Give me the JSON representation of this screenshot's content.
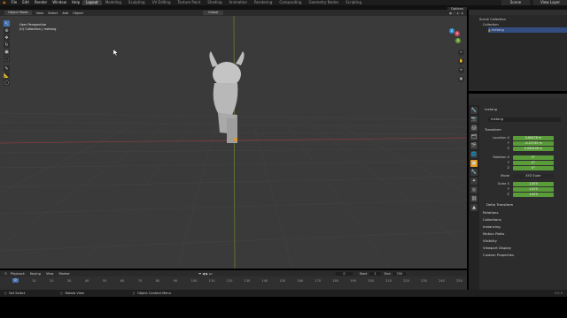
{
  "topbar": {
    "menus": [
      "File",
      "Edit",
      "Render",
      "Window",
      "Help"
    ],
    "workspaces": [
      "Layout",
      "Modeling",
      "Sculpting",
      "UV Editing",
      "Texture Paint",
      "Shading",
      "Animation",
      "Rendering",
      "Compositing",
      "Geometry Nodes",
      "Scripting"
    ],
    "active_workspace": "Layout",
    "scene_label": "Scene",
    "view_layer_label": "View Layer"
  },
  "viewport": {
    "mode": "Object Mode",
    "menus": [
      "View",
      "Select",
      "Add",
      "Object"
    ],
    "orientation": "Global",
    "options_label": "Options",
    "overlay_title": "User Perspective",
    "overlay_subtitle": "(0) Collection | metang",
    "axis_x": "X",
    "axis_y": "Y",
    "axis_z": "Z",
    "accent": "#4772b3"
  },
  "outliner": {
    "root": "Scene Collection",
    "collection": "Collection",
    "object": "metang"
  },
  "properties": {
    "object_name": "metang",
    "data_name": "metang",
    "transform_title": "Transform",
    "location_label": "Location X",
    "location": [
      "0.64478 m",
      "-0.25735 m",
      "0.085446 m"
    ],
    "rotation_label": "Rotation X",
    "rotation": [
      "0°",
      "0°",
      "0°"
    ],
    "mode_label": "Mode",
    "mode_value": "XYZ Euler",
    "scale_label": "Scale X",
    "scale": [
      "1.875",
      "1.875",
      "1.875"
    ],
    "y_label": "Y",
    "z_label": "Z",
    "delta_title": "Delta Transform",
    "sections": [
      "Relations",
      "Collections",
      "Instancing",
      "Motion Paths",
      "Visibility",
      "Viewport Display",
      "Custom Properties"
    ],
    "field_color": "#5a9b3a"
  },
  "timeline": {
    "menus": [
      "Playback",
      "Keying",
      "View",
      "Marker"
    ],
    "current_frame": "0",
    "start_label": "Start",
    "start": "1",
    "end_label": "End",
    "end": "250",
    "ticks": [
      "0",
      "10",
      "20",
      "30",
      "40",
      "50",
      "60",
      "70",
      "80",
      "90",
      "100",
      "110",
      "120",
      "130",
      "140",
      "150",
      "160",
      "170",
      "180",
      "190",
      "200",
      "210",
      "220",
      "230",
      "240",
      "250"
    ]
  },
  "statusbar": {
    "select": "Set Select",
    "rotate": "Rotate View",
    "context": "Object Context Menu",
    "version": "3.0.0"
  }
}
